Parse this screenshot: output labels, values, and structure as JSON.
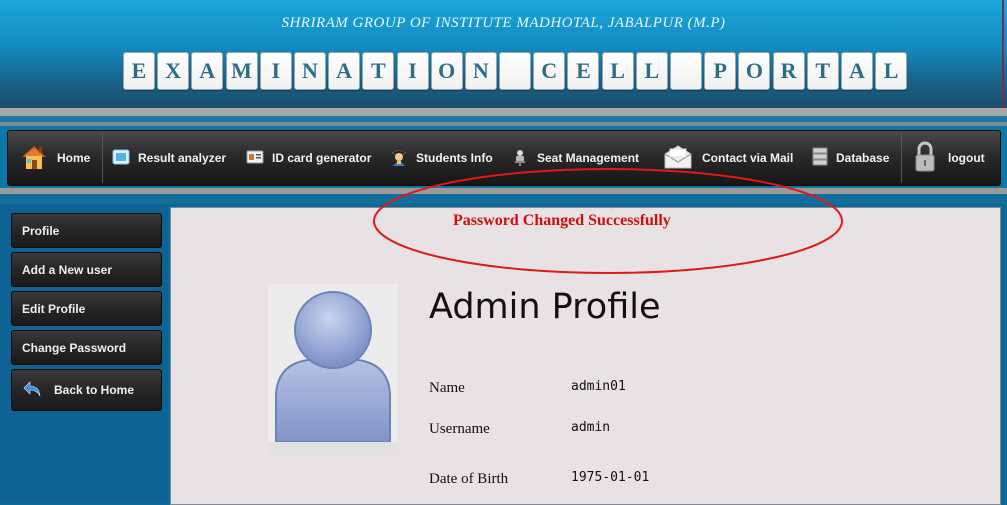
{
  "header": {
    "institute": "SHRIRAM GROUP OF INSTITUTE MADHOTAL, JABALPUR (M.P)",
    "title_letters": [
      "E",
      "X",
      "A",
      "M",
      "I",
      "N",
      "A",
      "T",
      "I",
      "O",
      "N",
      " ",
      "C",
      "E",
      "L",
      "L",
      " ",
      "P",
      "O",
      "R",
      "T",
      "A",
      "L"
    ]
  },
  "nav": {
    "home": "Home",
    "result_analyzer": "Result analyzer",
    "id_card_generator": "ID card generator",
    "students_info": "Students Info",
    "seat_management": "Seat Management",
    "contact_via_mail": "Contact via Mail",
    "database": "Database",
    "logout": "logout"
  },
  "sidebar": {
    "items": [
      "Profile",
      "Add a New user",
      "Edit Profile",
      "Change Password",
      "Back to Home"
    ]
  },
  "main": {
    "success_message": "Password Changed Successfully",
    "profile_title": "Admin Profile",
    "fields": [
      {
        "label": "Name",
        "value": "admin01"
      },
      {
        "label": "Username",
        "value": "admin"
      },
      {
        "label": "Date of Birth",
        "value": "1975-01-01"
      }
    ]
  },
  "colors": {
    "accent_blue": "#0f6294",
    "message_red": "#d20d0d",
    "highlight_ellipse": "#e01818"
  },
  "icons": {
    "home": "house-icon",
    "result_analyzer": "screen-icon",
    "id_card_generator": "id-card-icon",
    "students_info": "student-icon",
    "seat_management": "seat-icon",
    "contact_via_mail": "envelope-icon",
    "database": "database-icon",
    "logout": "padlock-icon",
    "back_to_home": "back-arrow-icon"
  }
}
